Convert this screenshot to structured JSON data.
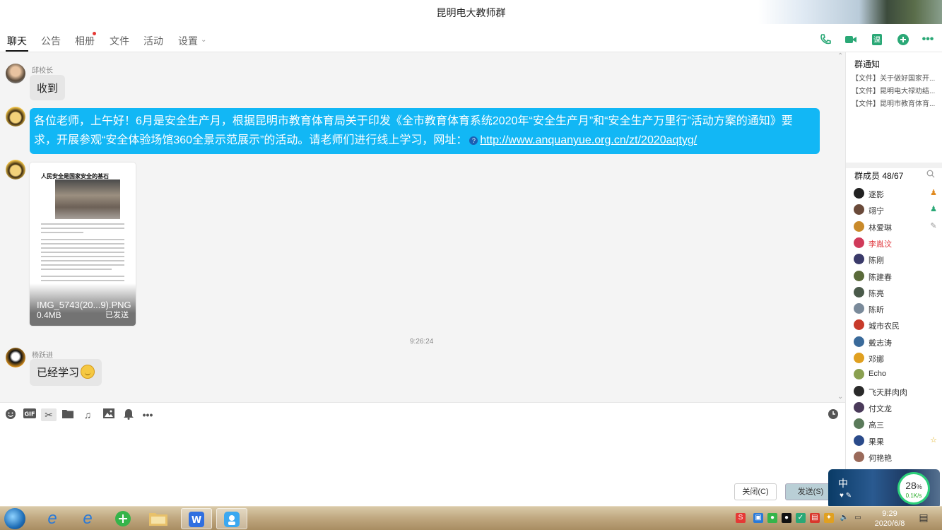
{
  "window": {
    "title": "昆明电大教师群"
  },
  "tabs": [
    {
      "label": "聊天"
    },
    {
      "label": "公告"
    },
    {
      "label": "相册"
    },
    {
      "label": "文件"
    },
    {
      "label": "活动"
    },
    {
      "label": "设置"
    }
  ],
  "messages": {
    "m1": {
      "sender": "邱校长",
      "text": "收到"
    },
    "m2": {
      "line1": "各位老师，上午好！6月是安全生产月，根据昆明市教育体育局关于印发《全市教育体育系统2020年“安全生产月”和“安全生产万里行”活动方案的通知》要",
      "line2": "求，开展参观“安全体验场馆360全景示范展示”的活动。请老师们进行线上学习，网址：",
      "link": "http://www.anquanyue.org.cn/zt/2020aqtyg/"
    },
    "m3": {
      "doc_title": "人民安全是国家安全的基石",
      "file_name": "IMG_5743(20...9).PNG",
      "file_size": "0.4MB",
      "status": "已发送"
    },
    "timestamp": "9:26:24",
    "m4": {
      "sender": "杨跃进",
      "text": "已经学习"
    }
  },
  "input": {
    "close_label": "关闭(C)",
    "send_label": "发送(S)"
  },
  "sidebar": {
    "notice_title": "群通知",
    "notices": [
      "【文件】关于做好国家开...",
      "【文件】昆明电大禄劝结...",
      "【文件】昆明市教育体育..."
    ],
    "members_title": "群成员 48/67",
    "members": [
      {
        "name": "逐影",
        "badge": "owner"
      },
      {
        "name": "翊宁",
        "badge": "admin"
      },
      {
        "name": "林爱琳",
        "badge": "edit"
      },
      {
        "name": "李胤汶",
        "highlight": true
      },
      {
        "name": "陈刚"
      },
      {
        "name": "陈建春"
      },
      {
        "name": "陈亮"
      },
      {
        "name": "陈昕"
      },
      {
        "name": "城市农民"
      },
      {
        "name": "戴志涛"
      },
      {
        "name": "邓娜"
      },
      {
        "name": "Echo"
      },
      {
        "name": "飞天胖肉肉"
      },
      {
        "name": "付文龙"
      },
      {
        "name": "高三"
      },
      {
        "name": "果果",
        "badge": "star"
      },
      {
        "name": "何艳艳"
      }
    ]
  },
  "widget": {
    "ime": "中",
    "percent": "28",
    "percent_unit": "%",
    "speed": "0.1K/s"
  },
  "taskbar": {
    "time": "9:29",
    "date": "2020/6/8"
  },
  "colors": {
    "accent": "#12b7f5",
    "green_icon": "#2aa876",
    "unread_dot": "#e53935",
    "highlight_member": "#e0383e"
  }
}
